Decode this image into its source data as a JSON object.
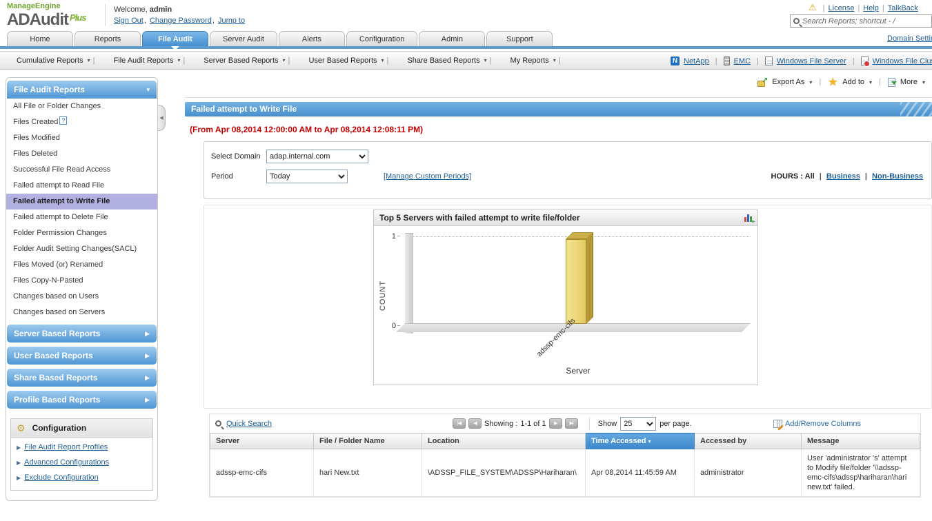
{
  "icons": {
    "dropdown": "▾",
    "collapsed": "▶",
    "expanded": "▾",
    "help": "?",
    "warning": "⚠",
    "gear": "⚙",
    "export_arrow": "↗",
    "sort_desc": "▾",
    "first": "|◀",
    "prev": "◀",
    "next": "▶",
    "last": "▶|",
    "bullet": "▶"
  },
  "header": {
    "brand_top": "ManageEngine",
    "brand_main": "ADAudit",
    "brand_plus": "Plus",
    "welcome_label": "Welcome,",
    "welcome_user": "admin",
    "links": [
      "Sign Out",
      "Change Password",
      "Jump to"
    ],
    "top_links": [
      "License",
      "Help",
      "TalkBack"
    ],
    "search_placeholder": "Search Reports; shortcut - /",
    "domain_settings": "Domain Settings"
  },
  "tabs": [
    {
      "label": "Home"
    },
    {
      "label": "Reports"
    },
    {
      "label": "File Audit",
      "active": true
    },
    {
      "label": "Server Audit"
    },
    {
      "label": "Alerts"
    },
    {
      "label": "Configuration"
    },
    {
      "label": "Admin"
    },
    {
      "label": "Support"
    }
  ],
  "menubar": {
    "menus": [
      "Cumulative Reports",
      "File Audit Reports",
      "Server Based Reports",
      "User Based Reports",
      "Share Based Reports",
      "My Reports"
    ],
    "netapp": "NetApp",
    "netapp_initial": "N",
    "emc": "EMC",
    "windows_file_server": "Windows File Server",
    "windows_file_cluster": "Windows File Cluster"
  },
  "sidebar": {
    "section_title": "File Audit Reports",
    "items": [
      {
        "label": "All File or Folder Changes"
      },
      {
        "label": "Files Created",
        "help": true
      },
      {
        "label": "Files Modified"
      },
      {
        "label": "Files Deleted"
      },
      {
        "label": "Successful File Read Access"
      },
      {
        "label": "Failed attempt to Read File"
      },
      {
        "label": "Failed attempt to Write File",
        "selected": true
      },
      {
        "label": "Failed attempt to Delete File"
      },
      {
        "label": "Folder Permission Changes"
      },
      {
        "label": "Folder Audit Setting Changes(SACL)"
      },
      {
        "label": "Files Moved (or) Renamed"
      },
      {
        "label": "Files Copy-N-Pasted"
      },
      {
        "label": "Changes based on Users"
      },
      {
        "label": "Changes based on Servers"
      }
    ],
    "sections": [
      "Server Based Reports",
      "User Based Reports",
      "Share Based Reports",
      "Profile Based Reports"
    ],
    "configuration": {
      "title": "Configuration",
      "links": [
        "File Audit Report Profiles",
        "Advanced Configurations",
        "Exclude Configuration"
      ]
    }
  },
  "toolbar": {
    "export_as": "Export As",
    "add_to": "Add to",
    "more": "More"
  },
  "report": {
    "title": "Failed attempt to Write File",
    "period_range": "(From Apr 08,2014 12:00:00 AM to Apr 08,2014 12:08:11 PM)",
    "select_domain_label": "Select Domain",
    "domain_value": "adap.internal.com",
    "period_label": "Period",
    "period_value": "Today",
    "manage_custom_periods": "[Manage Custom Periods]",
    "hours_label": "HOURS :",
    "hours_all": "All",
    "hours_business": "Business",
    "hours_nonbusiness": "Non-Business"
  },
  "chart_data": {
    "type": "bar",
    "title": "Top 5 Servers with failed attempt to write file/folder",
    "categories": [
      "adssp-emc-cifs"
    ],
    "values": [
      1
    ],
    "xlabel": "Server",
    "ylabel": "COUNT",
    "ylim": [
      0,
      1
    ],
    "yticks": [
      "1",
      "0"
    ],
    "legend": "none",
    "grid": "dotted horizontal gridline at y=1",
    "bar_color": "#e9d36c"
  },
  "table": {
    "quick_search": "Quick Search",
    "showing_label": "Showing :",
    "showing_range": "1-1 of 1",
    "show_label": "Show",
    "page_size": "25",
    "per_page_label": "per page.",
    "add_remove_columns": "Add/Remove Columns",
    "columns": [
      {
        "label": "Server"
      },
      {
        "label": "File / Folder Name"
      },
      {
        "label": "Location"
      },
      {
        "label": "Time Accessed",
        "sorted": true
      },
      {
        "label": "Accessed by"
      },
      {
        "label": "Message"
      }
    ],
    "rows": [
      {
        "server": "adssp-emc-cifs",
        "file": "hari New.txt",
        "location": "\\ADSSP_FILE_SYSTEM\\ADSSP\\Hariharan\\",
        "time": "Apr 08,2014 11:45:59 AM",
        "accessed_by": "administrator",
        "message": "User 'administrator 's' attempt to Modify file/folder '\\\\adssp-emc-cifs\\adssp\\hariharan\\hari new.txt' failed."
      }
    ]
  }
}
